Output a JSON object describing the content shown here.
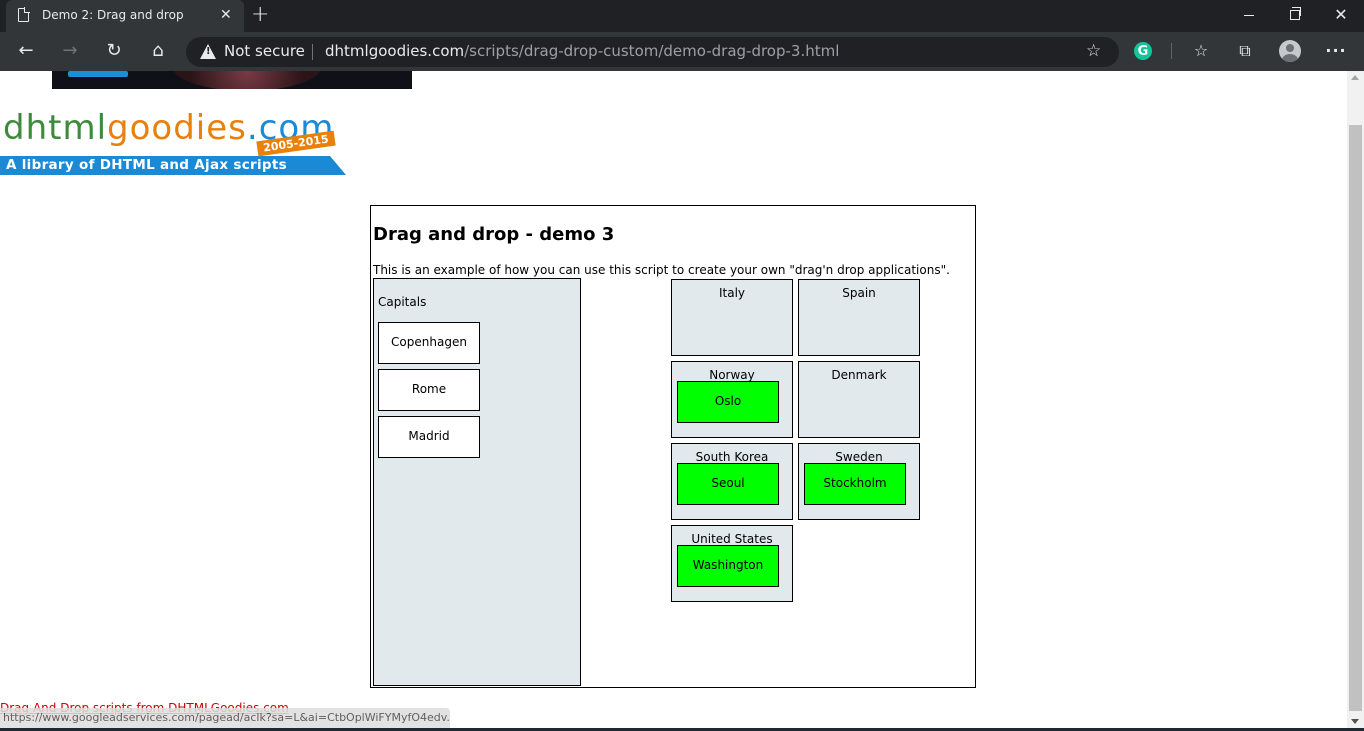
{
  "browser": {
    "tab_title": "Demo 2: Drag and drop",
    "security_label": "Not secure",
    "url_host": "dhtmlgoodies.com",
    "url_path": "/scripts/drag-drop-custom/demo-drag-drop-3.html",
    "status_url": "https://www.googleadservices.com/pagead/aclk?sa=L&ai=CtbOplWiFYMyfO4edv..."
  },
  "logo": {
    "part1": "dhtml",
    "part2": "goodies",
    "part3": ".com",
    "tagline": "A library of DHTML and Ajax scripts",
    "years": "2005-2015"
  },
  "demo": {
    "title": "Drag and drop - demo 3",
    "description": "This is an example of how you can use this script to create your own \"drag'n drop applications\".",
    "capitals_label": "Capitals",
    "capitals": [
      "Copenhagen",
      "Rome",
      "Madrid"
    ],
    "countries": [
      {
        "name": "Italy",
        "city": ""
      },
      {
        "name": "Spain",
        "city": ""
      },
      {
        "name": "Norway",
        "city": "Oslo"
      },
      {
        "name": "Denmark",
        "city": ""
      },
      {
        "name": "South Korea",
        "city": "Seoul"
      },
      {
        "name": "Sweden",
        "city": "Stockholm"
      },
      {
        "name": "United States",
        "city": "Washington"
      }
    ],
    "colors": {
      "drop_zone": "#e2e9ed",
      "placed_city": "#00ff00"
    }
  },
  "footer": {
    "link_text": "Drag And Drop scripts from DHTMLGoodies.com"
  }
}
